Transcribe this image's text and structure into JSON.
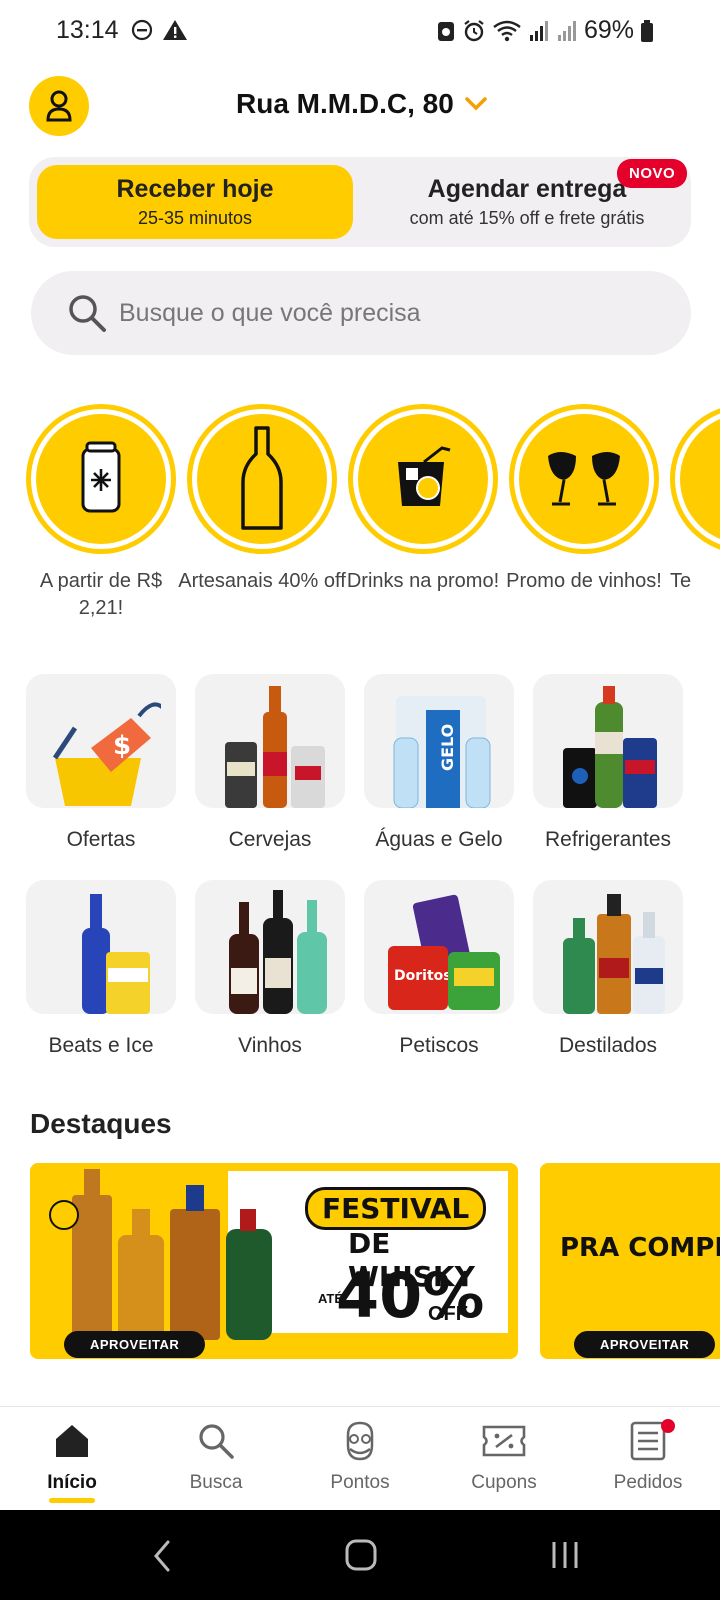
{
  "status_bar": {
    "time": "13:14",
    "battery": "69%"
  },
  "header": {
    "address": "Rua M.M.D.C, 80"
  },
  "delivery_toggle": {
    "today_title": "Receber hoje",
    "today_sub": "25-35 minutos",
    "schedule_title": "Agendar entrega",
    "schedule_sub": "com até 15% off e frete grátis",
    "new_badge": "NOVO"
  },
  "search": {
    "placeholder": "Busque o que você precisa"
  },
  "promos": [
    {
      "label": "A partir de R$ 2,21!",
      "icon": "can-icon"
    },
    {
      "label": "Artesanais 40% off",
      "icon": "bottle-icon"
    },
    {
      "label": "Drinks na promo!",
      "icon": "drink-glass-icon"
    },
    {
      "label": "Promo de vinhos!",
      "icon": "wine-glasses-icon"
    },
    {
      "label": "Te",
      "icon": "partial-icon"
    }
  ],
  "categories": [
    {
      "label": "Ofertas"
    },
    {
      "label": "Cervejas"
    },
    {
      "label": "Águas e Gelo"
    },
    {
      "label": "Refrigerantes"
    },
    {
      "label": "Beats e Ice"
    },
    {
      "label": "Vinhos"
    },
    {
      "label": "Petiscos"
    },
    {
      "label": "Destilados"
    }
  ],
  "highlights": {
    "title": "Destaques",
    "banner1": {
      "line1": "FESTIVAL",
      "line2": "DE WHISKY",
      "ate": "ATÉ",
      "percent": "40%",
      "off": "OFF",
      "cta": "APROVEITAR"
    },
    "banner2": {
      "text": "PRA COMPLETAR SUA ADEGA!",
      "cta": "APROVEITAR"
    }
  },
  "bottom_nav": [
    {
      "label": "Início",
      "icon": "home-icon",
      "active": true
    },
    {
      "label": "Busca",
      "icon": "search-icon"
    },
    {
      "label": "Pontos",
      "icon": "pontos-icon"
    },
    {
      "label": "Cupons",
      "icon": "coupon-icon"
    },
    {
      "label": "Pedidos",
      "icon": "orders-icon"
    }
  ],
  "colors": {
    "brand_yellow": "#FFCC00",
    "badge_red": "#E4002B"
  }
}
